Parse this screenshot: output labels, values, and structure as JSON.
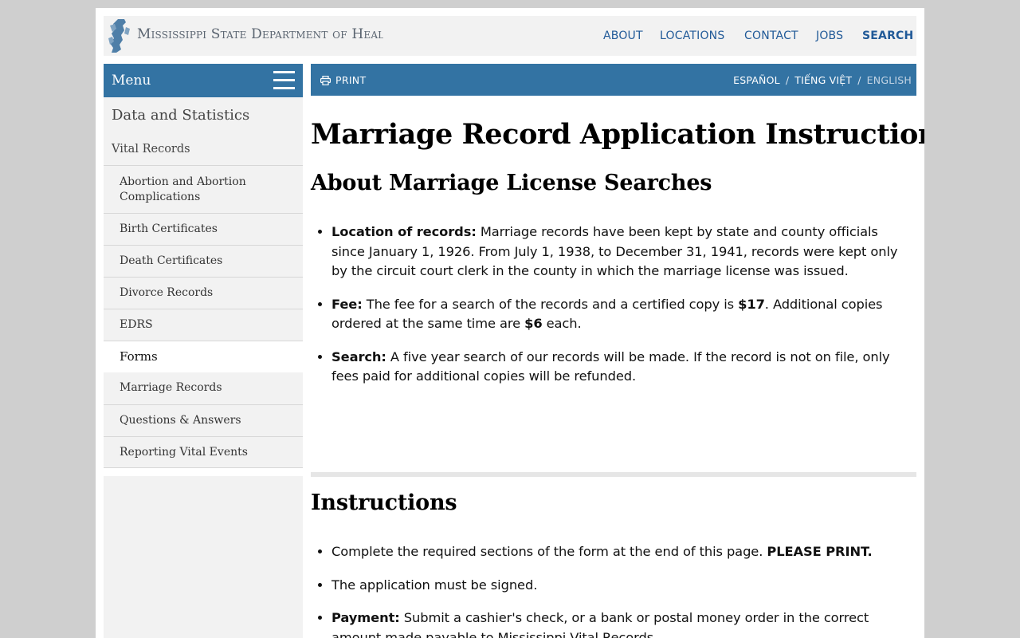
{
  "header": {
    "logo_text": "Mississippi State Department of Health",
    "nav": [
      {
        "label": "ABOUT",
        "bold": false
      },
      {
        "label": "LOCATIONS",
        "bold": false
      },
      {
        "label": "CONTACT",
        "bold": false
      },
      {
        "label": "JOBS",
        "bold": false
      },
      {
        "label": "SEARCH",
        "bold": true
      }
    ]
  },
  "sidebar": {
    "menu_label": "Menu",
    "title": "Data and Statistics",
    "section": "Vital Records",
    "items": [
      {
        "label": "Abortion and Abortion Complications",
        "lines": [
          "Abortion and Abortion",
          "Complications"
        ],
        "active": false
      },
      {
        "label": "Birth Certificates",
        "active": false
      },
      {
        "label": "Death Certificates",
        "active": false
      },
      {
        "label": "Divorce Records",
        "active": false
      },
      {
        "label": "EDRS",
        "active": false
      },
      {
        "label": "Forms",
        "active": true
      },
      {
        "label": "Marriage Records",
        "active": false
      },
      {
        "label": "Questions & Answers",
        "active": false
      },
      {
        "label": "Reporting Vital Events",
        "active": false
      }
    ]
  },
  "toolbar": {
    "print_label": "PRINT",
    "languages": [
      "ESPAÑOL",
      "TIẾNG VIỆT",
      "ENGLISH"
    ],
    "current_language": "ENGLISH",
    "separator": "/"
  },
  "main": {
    "title": "Marriage Record Application Instructions",
    "about_heading": "About Marriage License Searches",
    "about_items": [
      {
        "label": "Location of records:",
        "text": " Marriage records have been kept by state and county officials since January 1, 1926. From July 1, 1938, to December 31, 1941, records were kept only by the circuit court clerk in the county in which the marriage license was issued."
      },
      {
        "label": "Fee:",
        "text_before": " The fee for a search of the records and a certified copy is ",
        "fee": "$17",
        "text_middle": ". Additional copies ordered at the same time are ",
        "extra_fee": "$6",
        "text_after": " each."
      },
      {
        "label": "Search:",
        "text": " A five year search of our records will be made. If the record is not on file, only fees paid for additional copies will be refunded."
      }
    ],
    "instructions_heading": "Instructions",
    "instruction_items": [
      {
        "text": "Complete the required sections of the form at the end of this page. ",
        "emphasis": "PLEASE PRINT."
      },
      {
        "text": "The application must be signed."
      },
      {
        "label": "Payment:",
        "text": " Submit a cashier's check, or a bank or postal money order in the correct amount made payable to Mississippi Vital Records."
      }
    ]
  },
  "colors": {
    "brand_blue": "#3373a3",
    "nav_link": "#215a98",
    "panel_gray": "#f2f2f2"
  }
}
